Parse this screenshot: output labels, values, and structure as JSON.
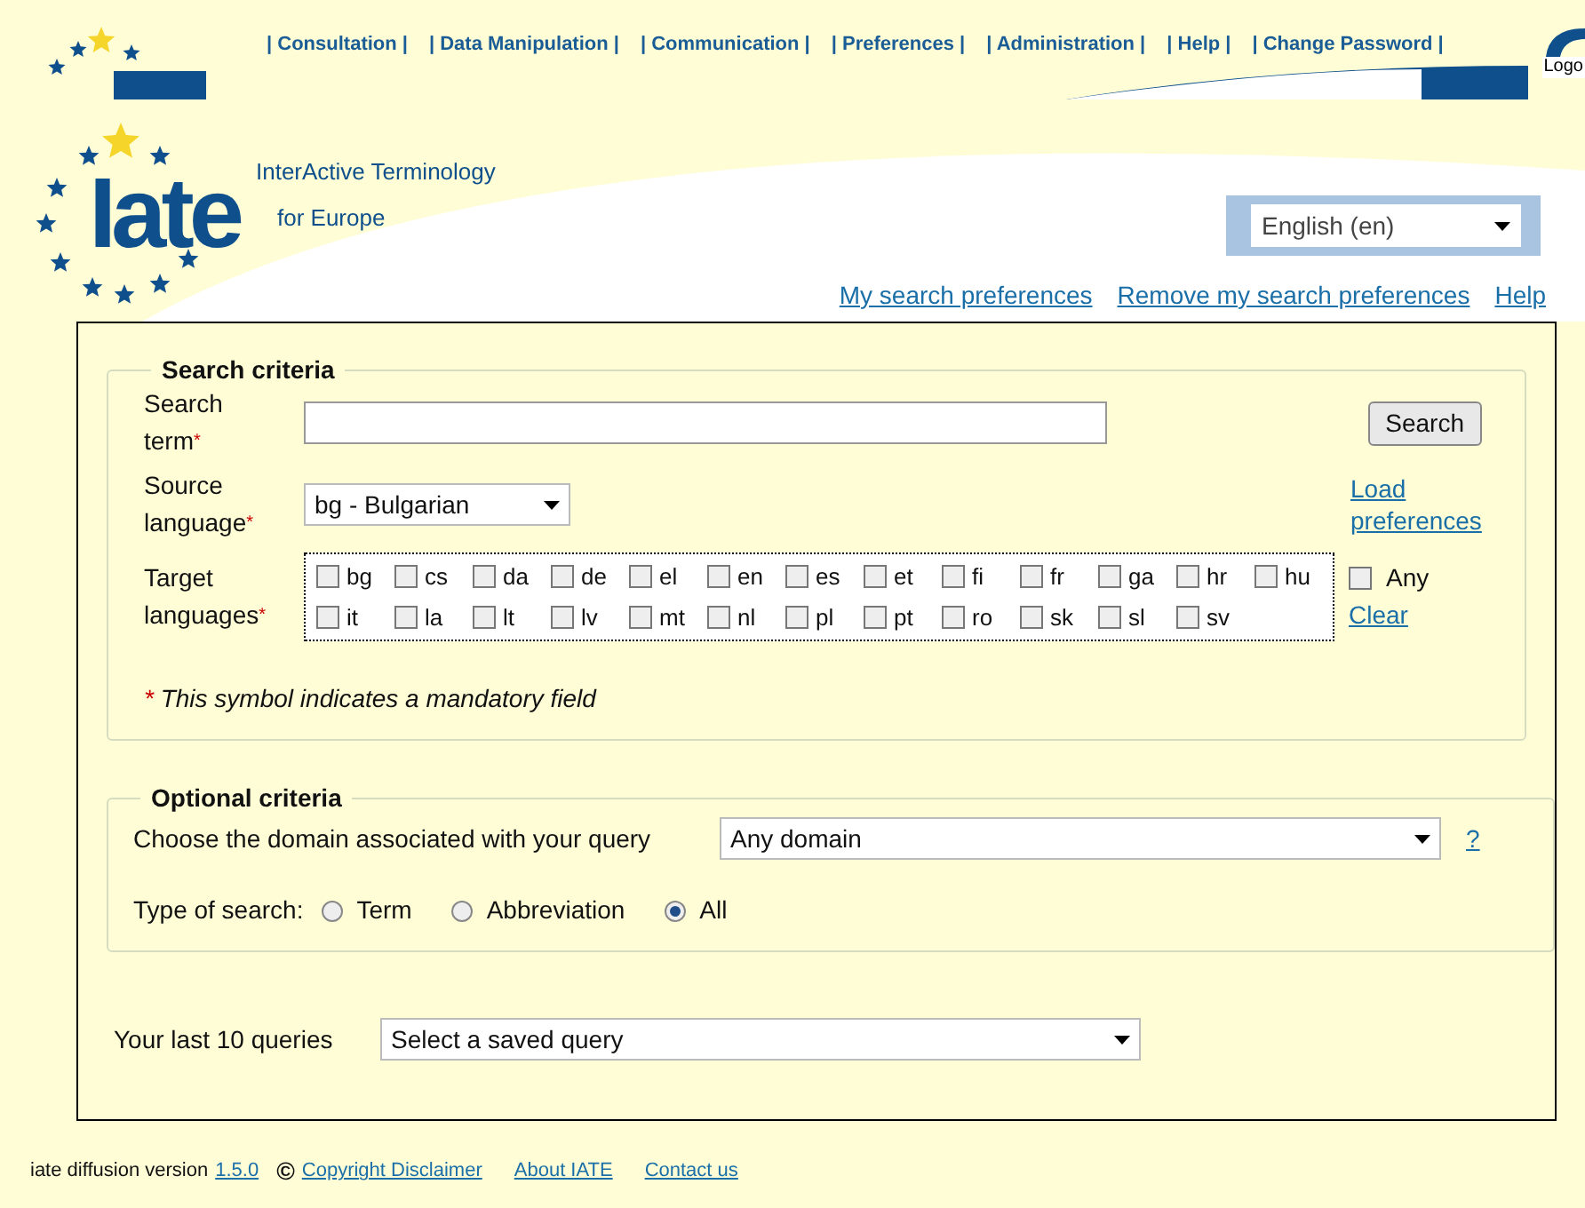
{
  "nav": [
    {
      "label": "| Consultation |"
    },
    {
      "label": "| Data Manipulation |"
    },
    {
      "label": "| Communication |"
    },
    {
      "label": "| Preferences |"
    },
    {
      "label": "| Administration |"
    },
    {
      "label": "| Help |"
    },
    {
      "label": "| Change Password |"
    }
  ],
  "logout": "Logo",
  "logo": {
    "mark": "Iate",
    "line1": "InterActive Terminology",
    "line2": "for Europe"
  },
  "interface_language": "English (en)",
  "header_links": [
    "My search preferences",
    "Remove my search preferences",
    "Help"
  ],
  "search_criteria": {
    "legend": "Search criteria",
    "term_label": "Search term",
    "search_button": "Search",
    "source_label": "Source language",
    "source_value": "bg - Bulgarian",
    "load_link": "Load preferences",
    "target_label": "Target languages",
    "targets": [
      {
        "code": "bg",
        "checked": false
      },
      {
        "code": "cs",
        "checked": false
      },
      {
        "code": "da",
        "checked": false
      },
      {
        "code": "de",
        "checked": false
      },
      {
        "code": "el",
        "checked": false
      },
      {
        "code": "en",
        "checked": false
      },
      {
        "code": "es",
        "checked": false
      },
      {
        "code": "et",
        "checked": false
      },
      {
        "code": "fi",
        "checked": false
      },
      {
        "code": "fr",
        "checked": false
      },
      {
        "code": "ga",
        "checked": false
      },
      {
        "code": "hr",
        "checked": false
      },
      {
        "code": "hu",
        "checked": false
      },
      {
        "code": "it",
        "checked": false
      },
      {
        "code": "la",
        "checked": false
      },
      {
        "code": "lt",
        "checked": false
      },
      {
        "code": "lv",
        "checked": false
      },
      {
        "code": "mt",
        "checked": false
      },
      {
        "code": "nl",
        "checked": false
      },
      {
        "code": "pl",
        "checked": false
      },
      {
        "code": "pt",
        "checked": false
      },
      {
        "code": "ro",
        "checked": false
      },
      {
        "code": "sk",
        "checked": false
      },
      {
        "code": "sl",
        "checked": false
      },
      {
        "code": "sv",
        "checked": false
      }
    ],
    "any": {
      "label": "Any",
      "checked": false
    },
    "clear_link": "Clear",
    "required_mark": "*",
    "note": "This symbol indicates a mandatory field"
  },
  "optional_criteria": {
    "legend": "Optional criteria",
    "domain_label": "Choose the domain associated with your query",
    "domain_value": "Any domain",
    "help_link": "?",
    "type_label": "Type of search:",
    "types": [
      {
        "label": "Term",
        "selected": false
      },
      {
        "label": "Abbreviation",
        "selected": false
      },
      {
        "label": "All",
        "selected": true
      }
    ]
  },
  "last_queries": {
    "label": "Your last 10 queries",
    "value": "Select a saved query"
  },
  "footer": {
    "version_label": "iate diffusion version",
    "version": "1.5.0",
    "copyright": "©",
    "links": [
      "Copyright Disclaimer",
      "About IATE",
      "Contact us"
    ]
  }
}
